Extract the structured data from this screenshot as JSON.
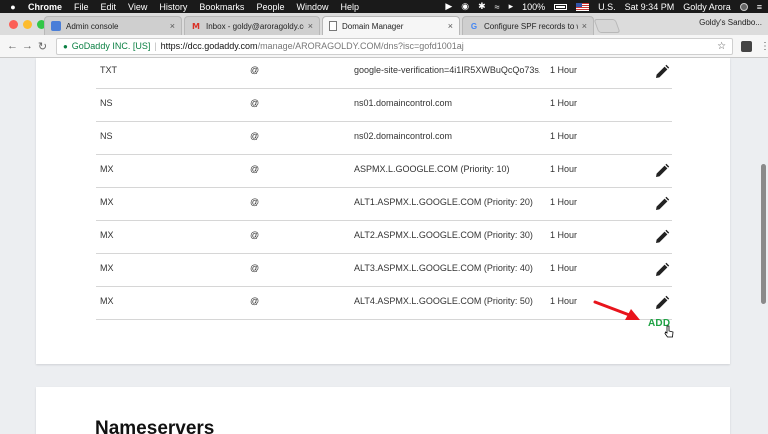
{
  "menubar": {
    "app": "Chrome",
    "items": [
      "File",
      "Edit",
      "View",
      "History",
      "Bookmarks",
      "People",
      "Window",
      "Help"
    ],
    "battery": "100%",
    "input_source": "U.S.",
    "clock": "Sat 9:34 PM",
    "user": "Goldy Arora"
  },
  "tabs": [
    {
      "label": "Admin console",
      "icon": "admin-console-icon"
    },
    {
      "label": "Inbox - goldy@aroragoldy.com",
      "icon": "gmail-icon"
    },
    {
      "label": "Domain Manager",
      "icon": "document-icon"
    },
    {
      "label": "Configure SPF records to work",
      "icon": "google-icon"
    }
  ],
  "profile": "Goldy's Sandbo...",
  "address": {
    "secure_label": "GoDaddy INC. [US]",
    "url_host": "https://dcc.godaddy.com",
    "url_path": "/manage/ARORAGOLDY.COM/dns?isc=gofd1001aj"
  },
  "records": [
    {
      "type": "TXT",
      "host": "@",
      "data": "google-site-verification=4i1IR5XWBuQcQo73s...",
      "ttl": "1 Hour",
      "editable": true
    },
    {
      "type": "NS",
      "host": "@",
      "data": "ns01.domaincontrol.com",
      "ttl": "1 Hour",
      "editable": false
    },
    {
      "type": "NS",
      "host": "@",
      "data": "ns02.domaincontrol.com",
      "ttl": "1 Hour",
      "editable": false
    },
    {
      "type": "MX",
      "host": "@",
      "data": "ASPMX.L.GOOGLE.COM (Priority: 10)",
      "ttl": "1 Hour",
      "editable": true
    },
    {
      "type": "MX",
      "host": "@",
      "data": "ALT1.ASPMX.L.GOOGLE.COM (Priority: 20)",
      "ttl": "1 Hour",
      "editable": true
    },
    {
      "type": "MX",
      "host": "@",
      "data": "ALT2.ASPMX.L.GOOGLE.COM (Priority: 30)",
      "ttl": "1 Hour",
      "editable": true
    },
    {
      "type": "MX",
      "host": "@",
      "data": "ALT3.ASPMX.L.GOOGLE.COM (Priority: 40)",
      "ttl": "1 Hour",
      "editable": true
    },
    {
      "type": "MX",
      "host": "@",
      "data": "ALT4.ASPMX.L.GOOGLE.COM (Priority: 50)",
      "ttl": "1 Hour",
      "editable": true
    }
  ],
  "add_label": "ADD",
  "nameservers_title": "Nameservers",
  "colors": {
    "add_green": "#1fa244",
    "arrow_red": "#e8141c",
    "secure_green": "#0b8043"
  }
}
